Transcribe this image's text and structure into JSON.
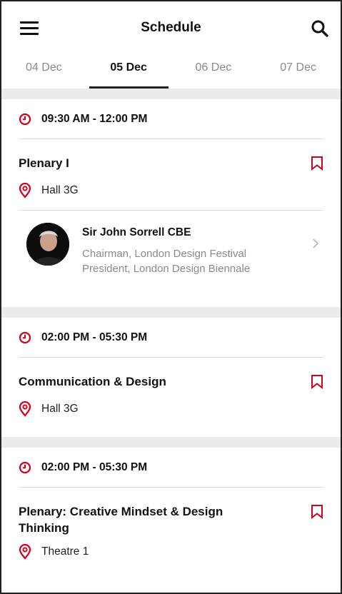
{
  "header": {
    "title": "Schedule"
  },
  "tabs": [
    {
      "label": "04 Dec",
      "active": false
    },
    {
      "label": "05 Dec",
      "active": true
    },
    {
      "label": "06 Dec",
      "active": false
    },
    {
      "label": "07 Dec",
      "active": false
    }
  ],
  "colors": {
    "accent": "#d0021b",
    "divider": "#dcdcdc",
    "section_gap": "#ececef"
  },
  "icons": [
    "menu-icon",
    "search-icon",
    "clock-icon",
    "bookmark-icon",
    "location-pin-icon",
    "chevron-right-icon"
  ],
  "sessions": [
    {
      "time": "09:30 AM - 12:00 PM",
      "title": "Plenary I",
      "location": "Hall 3G",
      "speaker": {
        "name": "Sir John Sorrell CBE",
        "role": "Chairman, London Design Festival\nPresident, London Design Biennale"
      }
    },
    {
      "time": "02:00 PM - 05:30 PM",
      "title": "Communication & Design",
      "location": "Hall 3G"
    },
    {
      "time": "02:00 PM - 05:30 PM",
      "title": "Plenary: Creative Mindset & Design Thinking",
      "location": "Theatre 1"
    }
  ]
}
